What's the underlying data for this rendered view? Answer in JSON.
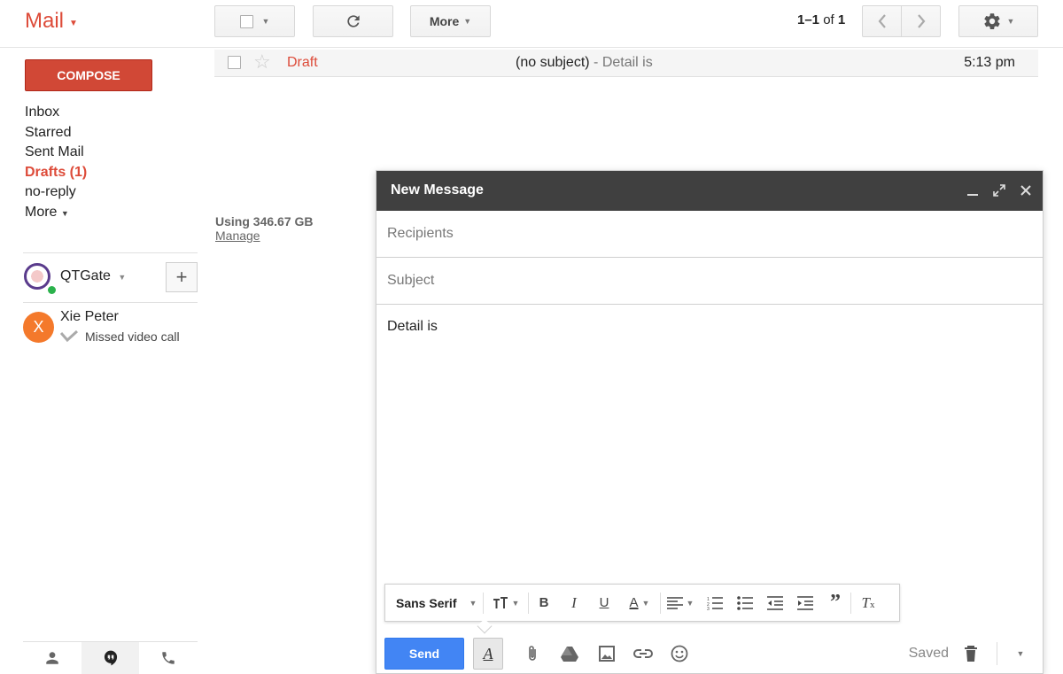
{
  "header": {
    "app_title": "Mail",
    "more_label": "More",
    "pager": {
      "range": "1–1",
      "of": "of",
      "total": "1"
    }
  },
  "sidebar": {
    "compose_label": "COMPOSE",
    "items": [
      {
        "label": "Inbox"
      },
      {
        "label": "Starred"
      },
      {
        "label": "Sent Mail"
      },
      {
        "label": "Drafts (1)"
      },
      {
        "label": "no-reply"
      },
      {
        "label": "More"
      }
    ]
  },
  "email_list": {
    "rows": [
      {
        "sender": "Draft",
        "subject": "(no subject)",
        "snippet": " - Detail is",
        "time": "5:13 pm"
      }
    ]
  },
  "storage": {
    "used": "Using 346.67 GB",
    "manage": "Manage"
  },
  "hangouts": {
    "user_name": "QTGate",
    "add_label": "+",
    "contacts": [
      {
        "initial": "X",
        "name": "Xie Peter",
        "status": "Missed video call"
      }
    ]
  },
  "compose_window": {
    "title": "New Message",
    "recipients_placeholder": "Recipients",
    "subject_placeholder": "Subject",
    "body": "Detail is",
    "font": "Sans Serif",
    "send_label": "Send",
    "saved_label": "Saved"
  },
  "colors": {
    "brand_red": "#dd4b39",
    "send_blue": "#4285f4",
    "header_dark": "#404040"
  }
}
